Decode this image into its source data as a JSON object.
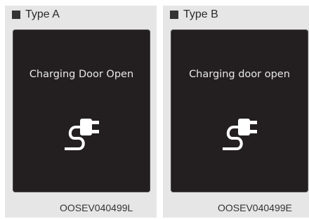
{
  "panels": [
    {
      "type_label": "Type A",
      "message": "Charging Door Open",
      "icon": "charging-plug-icon",
      "code": "OOSEV040499L"
    },
    {
      "type_label": "Type B",
      "message": "Charging door open",
      "icon": "charging-plug-icon",
      "code": "OOSEV040499E"
    }
  ],
  "colors": {
    "panel_bg": "#e6e6e6",
    "screen_bg": "#231f20",
    "screen_text": "#e8e8e8",
    "label_text": "#2a2a2a"
  }
}
